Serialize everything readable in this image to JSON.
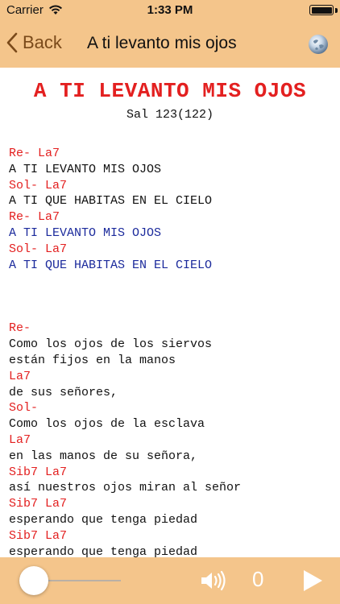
{
  "status": {
    "carrier": "Carrier",
    "time": "1:33 PM"
  },
  "nav": {
    "back_label": "Back",
    "title": "A ti levanto mis ojos"
  },
  "song": {
    "title": "A TI LEVANTO MIS OJOS",
    "reference": "Sal 123(122)",
    "block1": [
      {
        "text": "Re- La7",
        "kind": "chord"
      },
      {
        "text": "A TI LEVANTO MIS OJOS",
        "kind": "verse"
      },
      {
        "text": "Sol- La7",
        "kind": "chord"
      },
      {
        "text": "A TI QUE HABITAS EN EL CIELO",
        "kind": "verse"
      },
      {
        "text": "Re- La7",
        "kind": "chord"
      },
      {
        "text": "A TI LEVANTO MIS OJOS",
        "kind": "refrain"
      },
      {
        "text": "Sol- La7",
        "kind": "chord"
      },
      {
        "text": "A TI QUE HABITAS EN EL CIELO",
        "kind": "refrain"
      }
    ],
    "block2": [
      {
        "text": "Re-",
        "kind": "chord"
      },
      {
        "text": "Como los ojos de los siervos",
        "kind": "verse"
      },
      {
        "text": "están fijos en la manos",
        "kind": "verse"
      },
      {
        "text": "La7",
        "kind": "chord"
      },
      {
        "text": "de sus señores,",
        "kind": "verse"
      },
      {
        "text": "Sol-",
        "kind": "chord"
      },
      {
        "text": "Como los ojos de la esclava",
        "kind": "verse"
      },
      {
        "text": "La7",
        "kind": "chord"
      },
      {
        "text": "en las manos de su señora,",
        "kind": "verse"
      },
      {
        "text": "Sib7 La7",
        "kind": "chord"
      },
      {
        "text": "así nuestros ojos miran al señor",
        "kind": "verse"
      },
      {
        "text": "Sib7 La7",
        "kind": "chord"
      },
      {
        "text": "esperando que tenga piedad",
        "kind": "verse"
      },
      {
        "text": "Sib7 La7",
        "kind": "chord"
      },
      {
        "text": "esperando que tenga piedad",
        "kind": "verse"
      }
    ]
  },
  "player": {
    "elapsed": "0",
    "progress": 0
  },
  "icons": {
    "back": "chevron-left-icon",
    "web": "globe-icon",
    "volume": "speaker-icon",
    "play": "play-icon"
  },
  "colors": {
    "bar_background": "#f4c58b",
    "chord": "#e32020",
    "refrain": "#1b2a9c",
    "back_tint": "#7a4a1a"
  }
}
